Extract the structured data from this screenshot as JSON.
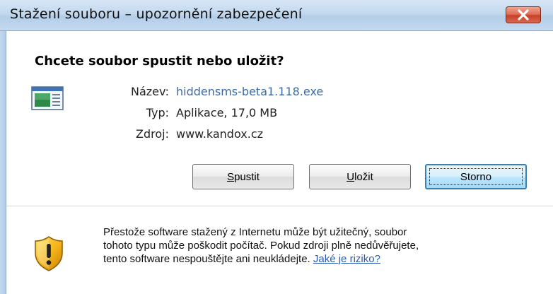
{
  "window": {
    "title": "Stažení souboru – upozornění zabezpečení"
  },
  "dialog": {
    "heading": "Chcete soubor spustit nebo uložit?",
    "fields": [
      {
        "label": "Název:",
        "value": "hiddensms-beta1.118.exe"
      },
      {
        "label": "Typ:",
        "value": "Aplikace, 17,0 MB"
      },
      {
        "label": "Zdroj:",
        "value": "www.kandox.cz"
      }
    ],
    "buttons": {
      "run": {
        "access_key": "S",
        "rest": "pustit"
      },
      "save": {
        "access_key": "U",
        "rest": "ložit"
      },
      "cancel": "Storno"
    }
  },
  "warning": {
    "line1": "Přestože software stažený z Internetu může být užitečný, soubor",
    "line2": "tohoto typu může poškodit počítač. Pokud zdroji plně nedůvěřujete,",
    "line3_prefix": "tento software nespouštějte ani neukládejte. ",
    "link": "Jaké je riziko?"
  },
  "colors": {
    "titlebar": "#c3d8ee",
    "close_button": "#d9684f",
    "link": "#3b6aa8",
    "default_button_border": "#3c7fb1"
  },
  "icons": {
    "close": "close-icon",
    "file": "application-file-icon",
    "shield": "security-warning-shield-icon"
  }
}
